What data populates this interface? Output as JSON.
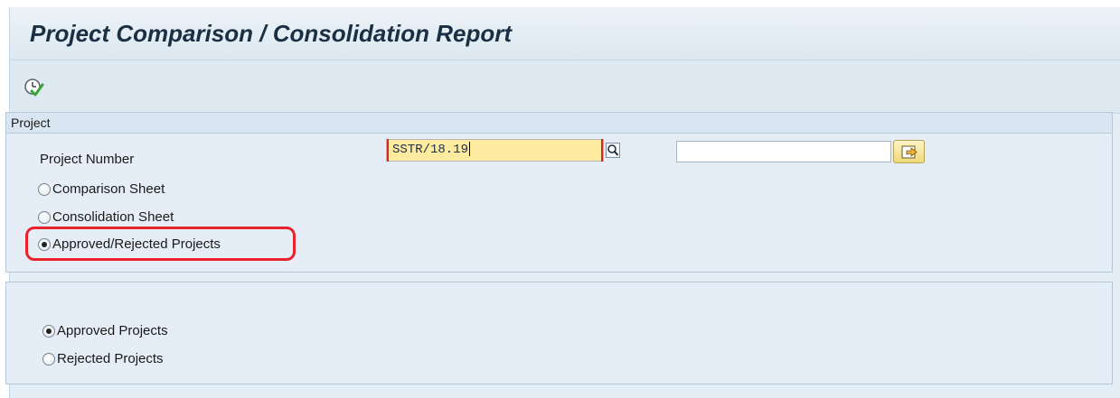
{
  "window": {
    "title": "Project Comparison / Consolidation Report"
  },
  "toolbar": {
    "execute_icon": "execute-clock-check-icon"
  },
  "project_group": {
    "header": "Project",
    "project_number_label": "Project Number",
    "project_number_value": "SSTR/18.19",
    "project_number_to_value": "",
    "f4_icon": "search-magnifier-icon",
    "multiple_selection_icon": "multiple-selection-arrow-icon",
    "report_options": [
      {
        "label": "Comparison Sheet",
        "selected": false
      },
      {
        "label": "Consolidation Sheet",
        "selected": false
      },
      {
        "label": "Approved/Rejected Projects",
        "selected": true
      }
    ],
    "highlight_color": "#e8232b"
  },
  "status_group": {
    "options": [
      {
        "label": "Approved Projects",
        "selected": true
      },
      {
        "label": "Rejected Projects",
        "selected": false
      }
    ]
  },
  "colors": {
    "background": "#e4eef6",
    "input_active": "#ffeba0",
    "title_text": "#1b2f44"
  }
}
